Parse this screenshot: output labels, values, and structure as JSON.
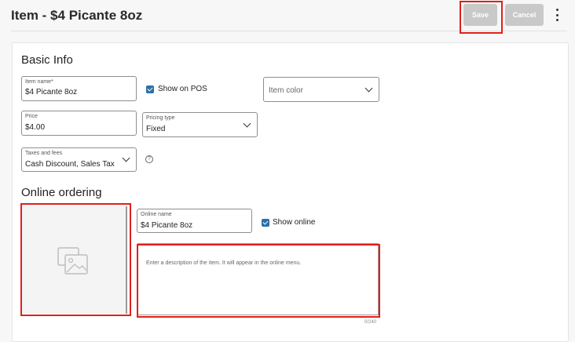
{
  "header": {
    "title": "Item - $4 Picante 8oz",
    "save_label": "Save",
    "cancel_label": "Cancel"
  },
  "basic_info": {
    "heading": "Basic Info",
    "item_name": {
      "label": "Item name*",
      "value": "$4 Picante 8oz"
    },
    "show_on_pos": {
      "label": "Show on POS",
      "checked": true
    },
    "item_color": {
      "placeholder": "Item color"
    },
    "price": {
      "label": "Price",
      "value": "$4.00"
    },
    "pricing_type": {
      "label": "Pricing type",
      "value": "Fixed"
    },
    "taxes": {
      "label": "Taxes and fees",
      "value": "Cash Discount, Sales Tax"
    }
  },
  "online_ordering": {
    "heading": "Online ordering",
    "online_name": {
      "label": "Online name",
      "value": "$4 Picante 8oz"
    },
    "show_online": {
      "label": "Show online",
      "checked": true
    },
    "description": {
      "placeholder": "Enter a description of the item. It will appear in the online menu."
    },
    "char_counter": "0/240"
  },
  "colors": {
    "highlight": "#e0201c",
    "checkbox": "#2d6fa8",
    "button_disabled": "#c9c9c9"
  },
  "icons": [
    "kebab-menu-icon",
    "chevron-down-icon",
    "help-icon",
    "image-placeholder-icon",
    "checkbox-icon"
  ]
}
